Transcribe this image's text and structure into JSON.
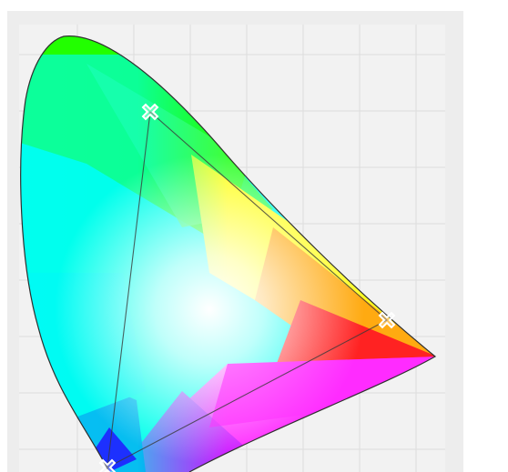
{
  "colors": {
    "panel_bg": "#ededed",
    "plot_bg": "#f2f2f2",
    "grid": "#dddddd",
    "locus_stroke": "#2f2f2f",
    "gamut_stroke": "#3a3a3a",
    "marker": "#ffffff"
  },
  "diagram": {
    "type": "chromaticity-diagram",
    "grid": true,
    "gamut_triangle": {
      "vertices": [
        "green",
        "red",
        "blue"
      ]
    }
  },
  "markers": [
    {
      "name": "green-primary",
      "icon": "cross-marker-icon"
    },
    {
      "name": "red-primary",
      "icon": "cross-marker-icon"
    },
    {
      "name": "blue-primary",
      "icon": "cross-marker-icon"
    }
  ]
}
